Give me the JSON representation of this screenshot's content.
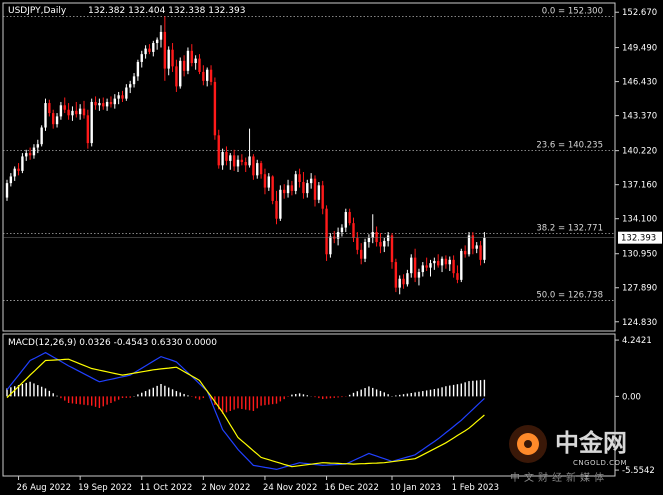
{
  "chart_data": [
    {
      "type": "candlestick",
      "symbol_label": "USDJPY,Daily",
      "ohlc_label": "132.382 132.404 132.338 132.393",
      "last_price_label": "132.393",
      "ylim": [
        124.0,
        153.5
      ],
      "y_ticks": [
        "152.670",
        "149.490",
        "146.430",
        "143.370",
        "140.220",
        "137.160",
        "134.100",
        "130.950",
        "127.890",
        "124.830"
      ],
      "y_tick_values": [
        152.67,
        149.49,
        146.43,
        143.37,
        140.22,
        137.16,
        134.1,
        130.95,
        127.89,
        124.83
      ],
      "fib_levels": [
        {
          "label": "0.0 = 152.300",
          "value": 152.3
        },
        {
          "label": "23.6 = 140.235",
          "value": 140.235
        },
        {
          "label": "38.2 = 132.771",
          "value": 132.771
        },
        {
          "label": "50.0 = 126.738",
          "value": 126.738
        }
      ],
      "bull_color": "#ffffff",
      "bear_color": "#ff1a1a",
      "candles": [
        [
          136.0,
          137.6,
          135.7,
          137.3
        ],
        [
          137.3,
          138.2,
          137.0,
          137.9
        ],
        [
          137.9,
          138.8,
          137.5,
          138.6
        ],
        [
          138.6,
          139.1,
          138.0,
          138.4
        ],
        [
          138.4,
          140.0,
          138.2,
          139.7
        ],
        [
          139.7,
          140.3,
          139.3,
          140.0
        ],
        [
          140.0,
          140.5,
          139.4,
          139.8
        ],
        [
          139.8,
          140.8,
          139.5,
          140.5
        ],
        [
          140.5,
          141.2,
          140.0,
          140.8
        ],
        [
          140.8,
          142.5,
          140.6,
          142.3
        ],
        [
          142.3,
          144.9,
          142.0,
          144.5
        ],
        [
          144.5,
          144.8,
          143.3,
          143.6
        ],
        [
          143.6,
          143.9,
          142.2,
          142.6
        ],
        [
          142.6,
          143.6,
          142.3,
          143.3
        ],
        [
          143.3,
          144.6,
          143.0,
          144.3
        ],
        [
          144.3,
          145.0,
          143.6,
          143.9
        ],
        [
          143.9,
          144.5,
          143.0,
          143.4
        ],
        [
          143.4,
          144.2,
          142.9,
          143.8
        ],
        [
          143.8,
          144.6,
          143.2,
          143.5
        ],
        [
          143.5,
          144.4,
          143.0,
          144.0
        ],
        [
          144.0,
          144.7,
          143.1,
          143.4
        ],
        [
          143.4,
          143.9,
          140.4,
          140.9
        ],
        [
          140.9,
          144.9,
          140.6,
          144.6
        ],
        [
          144.6,
          145.1,
          143.9,
          144.3
        ],
        [
          144.3,
          144.9,
          143.8,
          144.5
        ],
        [
          144.5,
          145.0,
          143.9,
          144.2
        ],
        [
          144.2,
          144.9,
          143.8,
          144.6
        ],
        [
          144.6,
          145.1,
          144.1,
          144.4
        ],
        [
          144.4,
          145.3,
          144.0,
          144.9
        ],
        [
          144.9,
          145.5,
          144.4,
          145.2
        ],
        [
          145.2,
          145.6,
          144.6,
          144.9
        ],
        [
          144.9,
          146.2,
          144.7,
          145.9
        ],
        [
          145.9,
          146.5,
          145.4,
          146.2
        ],
        [
          146.2,
          147.2,
          145.9,
          146.9
        ],
        [
          146.9,
          148.4,
          146.5,
          148.2
        ],
        [
          148.2,
          149.2,
          147.7,
          148.9
        ],
        [
          148.9,
          149.7,
          148.5,
          149.4
        ],
        [
          149.4,
          149.8,
          148.9,
          149.1
        ],
        [
          149.1,
          150.1,
          148.7,
          149.9
        ],
        [
          149.9,
          150.4,
          149.3,
          150.2
        ],
        [
          150.2,
          151.5,
          149.5,
          150.9
        ],
        [
          150.9,
          152.3,
          146.5,
          147.6
        ],
        [
          147.6,
          149.6,
          147.0,
          149.3
        ],
        [
          149.3,
          149.9,
          147.3,
          147.8
        ],
        [
          147.8,
          148.4,
          145.5,
          146.0
        ],
        [
          146.0,
          148.6,
          145.8,
          148.3
        ],
        [
          148.3,
          148.8,
          146.9,
          147.4
        ],
        [
          147.4,
          149.5,
          147.1,
          149.2
        ],
        [
          149.2,
          149.8,
          147.8,
          148.1
        ],
        [
          148.1,
          148.8,
          147.5,
          148.5
        ],
        [
          148.5,
          148.9,
          147.1,
          147.3
        ],
        [
          147.3,
          147.9,
          146.1,
          146.5
        ],
        [
          146.5,
          147.7,
          146.0,
          147.5
        ],
        [
          147.5,
          147.9,
          146.1,
          146.4
        ],
        [
          146.4,
          146.8,
          141.2,
          141.6
        ],
        [
          141.6,
          142.1,
          138.6,
          138.9
        ],
        [
          138.9,
          140.4,
          138.5,
          140.1
        ],
        [
          140.1,
          140.6,
          138.9,
          139.3
        ],
        [
          139.3,
          140.0,
          138.5,
          139.8
        ],
        [
          139.8,
          140.3,
          138.4,
          138.8
        ],
        [
          138.8,
          139.8,
          138.3,
          139.4
        ],
        [
          139.4,
          139.9,
          138.9,
          139.2
        ],
        [
          139.2,
          139.6,
          138.3,
          138.9
        ],
        [
          138.9,
          142.2,
          138.7,
          139.7
        ],
        [
          139.7,
          139.9,
          137.6,
          138.0
        ],
        [
          138.0,
          139.4,
          137.7,
          139.1
        ],
        [
          139.1,
          139.3,
          137.7,
          138.1
        ],
        [
          138.1,
          138.6,
          136.3,
          136.9
        ],
        [
          136.9,
          138.2,
          136.6,
          137.9
        ],
        [
          137.9,
          138.0,
          135.4,
          135.7
        ],
        [
          135.7,
          136.6,
          133.6,
          134.1
        ],
        [
          134.1,
          137.1,
          133.9,
          136.7
        ],
        [
          136.7,
          137.2,
          135.9,
          136.4
        ],
        [
          136.4,
          137.6,
          136.0,
          137.1
        ],
        [
          137.1,
          137.5,
          136.2,
          136.6
        ],
        [
          136.6,
          138.4,
          136.3,
          138.1
        ],
        [
          138.1,
          138.6,
          136.9,
          137.4
        ],
        [
          137.4,
          138.3,
          135.9,
          136.4
        ],
        [
          136.4,
          137.6,
          136.0,
          137.3
        ],
        [
          137.3,
          138.2,
          136.8,
          137.7
        ],
        [
          137.7,
          138.0,
          135.2,
          135.8
        ],
        [
          135.8,
          137.4,
          135.5,
          137.1
        ],
        [
          137.1,
          137.5,
          134.5,
          135.0
        ],
        [
          135.0,
          135.3,
          130.3,
          130.9
        ],
        [
          130.9,
          132.8,
          130.6,
          132.5
        ],
        [
          132.5,
          133.0,
          131.9,
          132.3
        ],
        [
          132.3,
          133.3,
          131.7,
          132.9
        ],
        [
          132.9,
          133.6,
          132.5,
          133.3
        ],
        [
          133.3,
          135.0,
          132.9,
          134.7
        ],
        [
          134.7,
          135.0,
          133.5,
          133.7
        ],
        [
          133.7,
          134.2,
          132.0,
          132.4
        ],
        [
          132.4,
          132.9,
          130.9,
          131.3
        ],
        [
          131.3,
          131.9,
          130.0,
          130.5
        ],
        [
          130.5,
          132.3,
          130.2,
          132.0
        ],
        [
          132.0,
          132.7,
          131.5,
          132.4
        ],
        [
          132.4,
          134.5,
          131.9,
          132.9
        ],
        [
          132.9,
          133.4,
          131.6,
          132.0
        ],
        [
          132.0,
          132.8,
          131.0,
          131.6
        ],
        [
          131.6,
          132.4,
          131.1,
          132.1
        ],
        [
          132.1,
          132.9,
          131.6,
          132.6
        ],
        [
          132.6,
          132.8,
          129.6,
          130.2
        ],
        [
          130.2,
          130.5,
          127.5,
          127.9
        ],
        [
          127.9,
          129.0,
          127.3,
          128.7
        ],
        [
          128.7,
          129.1,
          127.8,
          128.2
        ],
        [
          128.2,
          129.5,
          128.0,
          129.2
        ],
        [
          129.2,
          130.9,
          128.8,
          130.6
        ],
        [
          130.6,
          131.4,
          128.4,
          128.8
        ],
        [
          128.8,
          129.6,
          128.1,
          129.3
        ],
        [
          129.3,
          130.2,
          128.9,
          129.9
        ],
        [
          129.9,
          130.6,
          129.4,
          129.7
        ],
        [
          129.7,
          130.4,
          128.9,
          130.1
        ],
        [
          130.1,
          130.6,
          129.5,
          130.3
        ],
        [
          130.3,
          130.9,
          129.7,
          129.9
        ],
        [
          129.9,
          130.7,
          129.3,
          130.5
        ],
        [
          130.5,
          130.8,
          129.6,
          130.0
        ],
        [
          130.0,
          130.7,
          129.4,
          130.4
        ],
        [
          130.4,
          130.8,
          128.8,
          129.2
        ],
        [
          129.2,
          129.9,
          128.3,
          128.6
        ],
        [
          128.6,
          131.4,
          128.4,
          131.2
        ],
        [
          131.2,
          131.7,
          130.6,
          130.9
        ],
        [
          130.9,
          132.9,
          130.7,
          132.6
        ],
        [
          132.6,
          132.9,
          130.9,
          131.4
        ],
        [
          131.4,
          132.0,
          131.0,
          131.7
        ],
        [
          131.7,
          132.1,
          129.9,
          130.4
        ],
        [
          130.4,
          132.9,
          130.1,
          132.393
        ]
      ],
      "x_ticks": [
        {
          "label": "26 Aug 2022",
          "index": 3
        },
        {
          "label": "19 Sep 2022",
          "index": 19
        },
        {
          "label": "11 Oct 2022",
          "index": 35
        },
        {
          "label": "2 Nov 2022",
          "index": 51
        },
        {
          "label": "24 Nov 2022",
          "index": 67
        },
        {
          "label": "16 Dec 2022",
          "index": 83
        },
        {
          "label": "10 Jan 2023",
          "index": 100
        },
        {
          "label": "1 Feb 2023",
          "index": 116
        }
      ]
    },
    {
      "type": "macd",
      "label": "MACD(12,26,9) 0.0326 -0.4543 0.6330 0.0000",
      "ylim": [
        -6.0,
        4.7
      ],
      "y_ticks": [
        "4.2421",
        "0.00",
        "-5.5542"
      ],
      "y_tick_values": [
        4.2421,
        0.0,
        -5.5542
      ],
      "main_color": "#2040ff",
      "signal_color": "#ffff00",
      "hist_up_color": "#ffffff",
      "hist_down_color": "#ff1a1a",
      "main_keyframes": [
        [
          0,
          0.5
        ],
        [
          6,
          2.7
        ],
        [
          10,
          3.3
        ],
        [
          16,
          2.3
        ],
        [
          24,
          1.1
        ],
        [
          32,
          1.6
        ],
        [
          40,
          3.0
        ],
        [
          44,
          2.6
        ],
        [
          52,
          0.4
        ],
        [
          56,
          -2.5
        ],
        [
          60,
          -4.0
        ],
        [
          64,
          -5.2
        ],
        [
          70,
          -5.5
        ],
        [
          76,
          -5.0
        ],
        [
          82,
          -5.2
        ],
        [
          88,
          -5.1
        ],
        [
          94,
          -4.3
        ],
        [
          100,
          -4.9
        ],
        [
          106,
          -4.4
        ],
        [
          112,
          -3.2
        ],
        [
          118,
          -1.8
        ],
        [
          124,
          -0.15
        ]
      ],
      "signal_keyframes": [
        [
          0,
          -0.1
        ],
        [
          6,
          1.6
        ],
        [
          10,
          2.7
        ],
        [
          16,
          2.8
        ],
        [
          22,
          2.1
        ],
        [
          30,
          1.6
        ],
        [
          38,
          2.0
        ],
        [
          44,
          2.2
        ],
        [
          50,
          1.2
        ],
        [
          56,
          -1.2
        ],
        [
          60,
          -3.1
        ],
        [
          66,
          -4.6
        ],
        [
          74,
          -5.3
        ],
        [
          82,
          -5.0
        ],
        [
          90,
          -5.1
        ],
        [
          98,
          -5.0
        ],
        [
          106,
          -4.7
        ],
        [
          114,
          -3.5
        ],
        [
          120,
          -2.4
        ],
        [
          124,
          -1.4
        ]
      ],
      "watermark": {
        "text": "中金网",
        "url": "CNGOLD.COM",
        "sub": "中文财经新媒体"
      }
    }
  ]
}
